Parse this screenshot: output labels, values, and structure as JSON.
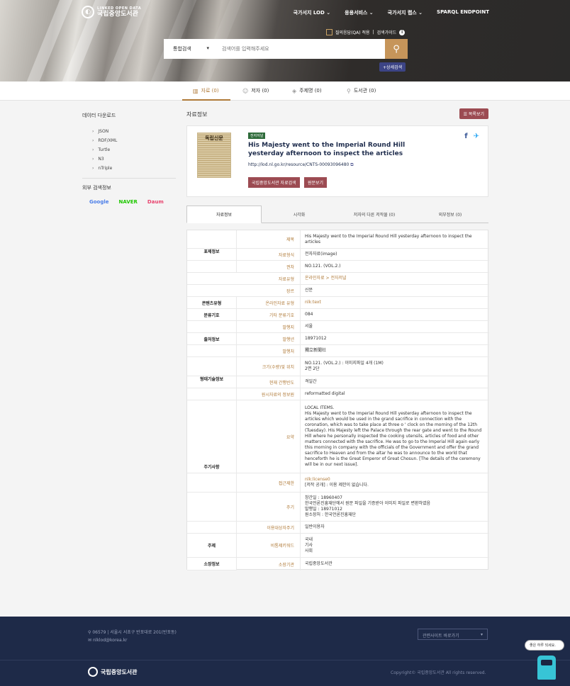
{
  "header": {
    "logo_top": "LINKED OPEN DATA",
    "logo_name": "국립중앙도서관",
    "nav": [
      "국가서지 LOD",
      "응용서비스",
      "국가서지 랩스",
      "SPARQL ENDPOINT"
    ],
    "qa_label": "질의응답(QA) 적용",
    "guide_label": "검색가이드",
    "search_select": "통합검색",
    "search_placeholder": "검색어를 입력해주세요",
    "advanced": "+상세검색"
  },
  "tabs": [
    {
      "label": "자료 (0)"
    },
    {
      "label": "저자 (0)"
    },
    {
      "label": "주제명 (0)"
    },
    {
      "label": "도서관 (0)"
    }
  ],
  "sidebar": {
    "download_title": "데이터 다운로드",
    "downloads": [
      "JSON",
      "RDF/XML",
      "Turtle",
      "N3",
      "nTriple"
    ],
    "external_title": "외부 검색정보",
    "engines": [
      "Google",
      "NAVER",
      "Daum"
    ]
  },
  "main": {
    "section_title": "자료정보",
    "list_button": "목록보기",
    "card": {
      "thumb_text": "독립신문",
      "badge": "전자저널",
      "title": "His Majesty went to the Imperial Round Hill yesterday afternoon to inspect the articles",
      "uri": "http://lod.nl.go.kr/resource/CNTS-00093096480",
      "btn_detail": "국립중앙도서관 자료검색",
      "btn_original": "원문보기"
    },
    "subtabs": [
      "자료정보",
      "시각화",
      "저자의 다른 저작물 (0)",
      "외부정보 (0)"
    ],
    "groups": [
      "표제정보",
      "콘텐츠유형",
      "분류기호",
      "출처정보",
      "형태기술정보",
      "주기사항",
      "주제",
      "소장정보"
    ],
    "rows": {
      "title_label": "제목",
      "title_value": "His Majesty went to the Imperial Round Hill yesterday afternoon to inspect the articles",
      "form_label": "자료형식",
      "form_value": "전자자료(image)",
      "vol_label": "권차",
      "vol_value": "NO.121. (VOL.2.)",
      "type_label": "자료유형",
      "type_value": "온라인자료 > 전자저널",
      "genre_label": "장르",
      "genre_value": "신문",
      "content_label": "온라인자료 유형",
      "content_value": "nlk:text",
      "class_label": "기타 분류기호",
      "class_value": "084",
      "place_label": "발행지",
      "place_value": "서울",
      "year_label": "발행년",
      "year_value": "18971012",
      "pub_label": "발행처",
      "pub_value": "獨立新聞社",
      "size_label": "크기(수량)및 위치",
      "size_value1": "NO.121. (VOL.2.) : 이미지파일 4개 (1M)",
      "size_value2": "2면 2단",
      "freq_label": "현재 간행빈도",
      "freq_value": "격일간",
      "orig_label": "원시자료의 정보원",
      "orig_value": "reformatted digital",
      "summary_label": "요약",
      "summary_lines": [
        "LOCAL ITEMS.",
        "His Majesty went to the Imperial Round Hill yesterday afternoon to inspect the",
        "articles which would be used in the grand sacrifice in connection with the",
        "coronation, which was to take place at three o ' clock on the morning of the 12th",
        "(Tuesday). His Majesty left the Palace through the rear gate and went to the Round",
        "Hill where he personally inspected the cooking utensils, articles of food and other",
        "matters connected with the sacrifice. He was to go to the Imperial Hill again early",
        "this morning in company with the officials of the Government and offer the grand",
        "sacrifice to Heaven and from the altar he was to announce to the world that",
        "henceforth he is the Great Emperor of Great Chosun. [The details of the ceremony",
        "will be in our next issue]."
      ],
      "access_label": "접근제한",
      "access_value1": "nlk:license0",
      "access_value2": "[저작 공개] : 이용 제한이 없습니다.",
      "note_label": "주기",
      "note_lines": [
        "창간일 : 18960407",
        "한국언론진흥재단에서 원문 파일을 기증받아 이미지 파일로 변환하였음",
        "발행일 : 18971012",
        "원소장처 : 한국언론진흥재단"
      ],
      "audience_label": "이용대상자주기",
      "audience_value": "일반이용자",
      "keyword_label": "비통제키워드",
      "keyword_lines": [
        "국내",
        "기사",
        "사회"
      ],
      "holder_label": "소장기관",
      "holder_value": "국립중앙도서관"
    }
  },
  "footer": {
    "address": "06579 | 서울시 서초구 반포대로 201(반포동)",
    "email": "nlklod@korea.kr",
    "related": "관련사이트 바로가기",
    "logo": "국립중앙도서관",
    "copyright": "Copyright© 국립중앙도서관 All rights reserved.",
    "chatbot": "좋은 하루 되세요."
  }
}
